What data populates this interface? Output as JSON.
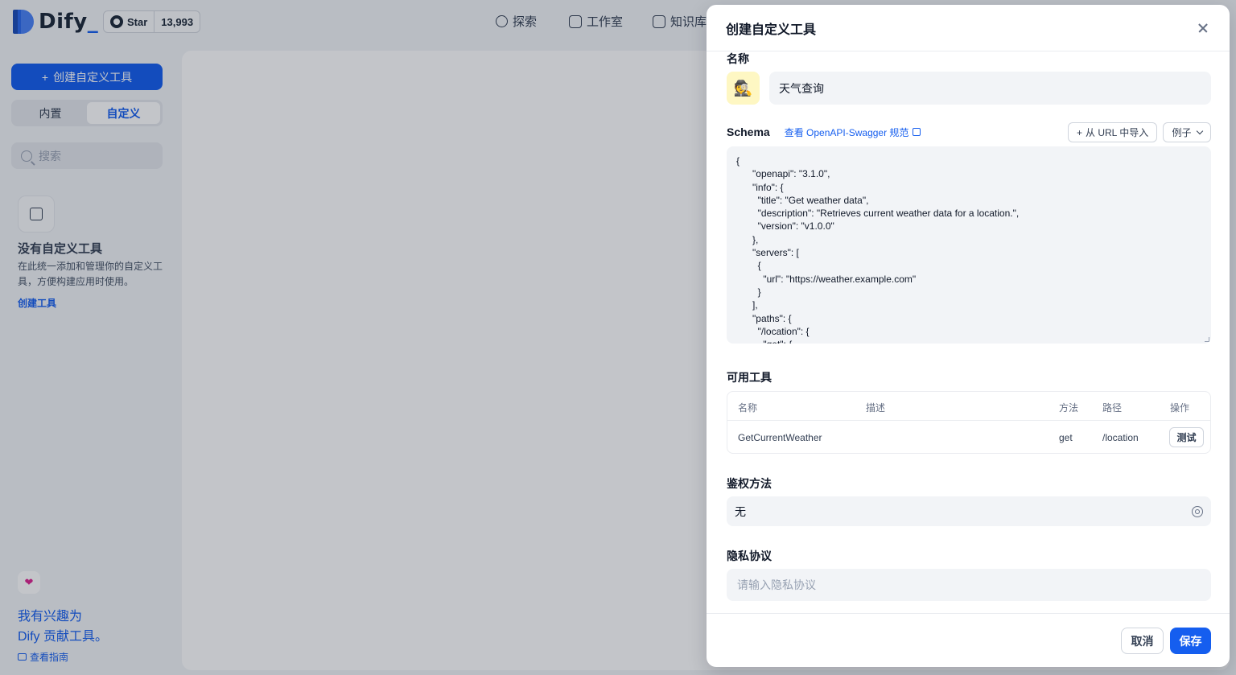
{
  "brand": {
    "name": "Dify",
    "underscore": "_"
  },
  "github": {
    "label": "Star",
    "count": "13,993"
  },
  "nav": {
    "explore": "探索",
    "studio": "工作室",
    "knowledge": "知识库"
  },
  "sidebar": {
    "create_label": "创建自定义工具",
    "tabs": [
      "内置",
      "自定义"
    ],
    "search_placeholder": "搜索",
    "empty_title": "没有自定义工具",
    "empty_desc": "在此统一添加和管理你的自定义工具，方便构建应用时使用。",
    "create_link": "创建工具",
    "contribute_line1": "我有兴趣为",
    "contribute_line2": "Dify 贡献工具。",
    "guide": "查看指南"
  },
  "drawer": {
    "title": "创建自定义工具",
    "name_label": "名称",
    "icon_emoji": "🕵️",
    "name_value": "天气查询",
    "schema_label": "Schema",
    "schema_link": "查看 OpenAPI-Swagger 规范",
    "import_url": "从 URL 中导入",
    "example": "例子",
    "schema_code": "{\n      \"openapi\": \"3.1.0\",\n      \"info\": {\n        \"title\": \"Get weather data\",\n        \"description\": \"Retrieves current weather data for a location.\",\n        \"version\": \"v1.0.0\"\n      },\n      \"servers\": [\n        {\n          \"url\": \"https://weather.example.com\"\n        }\n      ],\n      \"paths\": {\n        \"/location\": {\n          \"get\": {",
    "tools_label": "可用工具",
    "table": {
      "headers": [
        "名称",
        "描述",
        "方法",
        "路径",
        "操作"
      ],
      "rows": [
        {
          "name": "GetCurrentWeather",
          "description": "",
          "method": "get",
          "path": "/location",
          "action": "测试"
        }
      ]
    },
    "auth_label": "鉴权方法",
    "auth_value": "无",
    "privacy_label": "隐私协议",
    "privacy_placeholder": "请输入隐私协议",
    "cancel": "取消",
    "save": "保存"
  },
  "colors": {
    "primary": "#155eef",
    "overlay": "rgba(16,24,40,0.25)",
    "emoji_bg": "#fef7c3"
  }
}
